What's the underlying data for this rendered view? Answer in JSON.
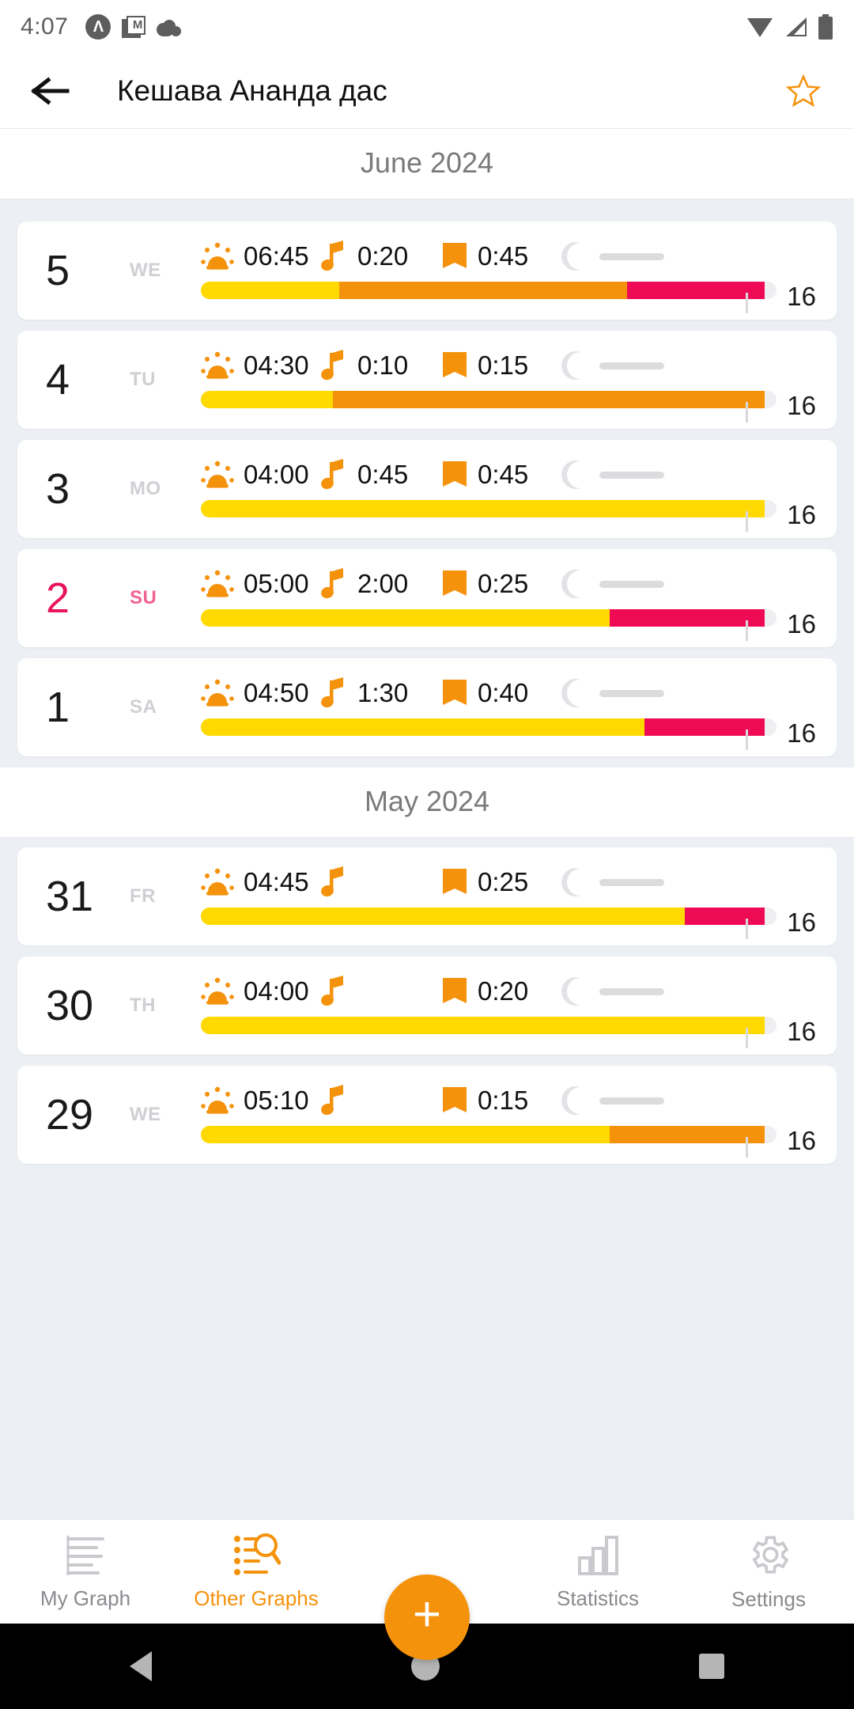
{
  "statusbar": {
    "time": "4:07",
    "icons_left": [
      "app-circle-icon",
      "gmail-icon",
      "cloud-icon"
    ],
    "icons_right": [
      "wifi-icon",
      "cellular-signal-icon",
      "battery-icon"
    ]
  },
  "appbar": {
    "back_icon": "back-arrow-icon",
    "title": "Кешава Ананда дас",
    "favorite_icon": "star-outline-icon",
    "favorite_color": "#f5920b"
  },
  "colors": {
    "accent": "#f5920b",
    "yellow": "#ffd900",
    "orange": "#f5920b",
    "crimson": "#ef0a55",
    "track": "#efeff2",
    "muted": "#d3d3d8"
  },
  "sections": [
    {
      "month": "June 2024",
      "days": [
        {
          "date": "5",
          "weekday": "WE",
          "weekend": false,
          "wake": "06:45",
          "music": "0:20",
          "reading": "0:45",
          "night": "",
          "segments": [
            {
              "color": "#ffd900",
              "pct": 24
            },
            {
              "color": "#f5920b",
              "pct": 50
            },
            {
              "color": "#ef0a55",
              "pct": 24
            }
          ],
          "score": "16"
        },
        {
          "date": "4",
          "weekday": "TU",
          "weekend": false,
          "wake": "04:30",
          "music": "0:10",
          "reading": "0:15",
          "night": "",
          "segments": [
            {
              "color": "#ffd900",
              "pct": 23
            },
            {
              "color": "#f5920b",
              "pct": 75
            }
          ],
          "score": "16"
        },
        {
          "date": "3",
          "weekday": "MO",
          "weekend": false,
          "wake": "04:00",
          "music": "0:45",
          "reading": "0:45",
          "night": "",
          "segments": [
            {
              "color": "#ffd900",
              "pct": 98
            }
          ],
          "score": "16"
        },
        {
          "date": "2",
          "weekday": "SU",
          "weekend": true,
          "wake": "05:00",
          "music": "2:00",
          "reading": "0:25",
          "night": "",
          "segments": [
            {
              "color": "#ffd900",
              "pct": 71
            },
            {
              "color": "#ef0a55",
              "pct": 27
            }
          ],
          "score": "16"
        },
        {
          "date": "1",
          "weekday": "SA",
          "weekend": false,
          "wake": "04:50",
          "music": "1:30",
          "reading": "0:40",
          "night": "",
          "segments": [
            {
              "color": "#ffd900",
              "pct": 77
            },
            {
              "color": "#ef0a55",
              "pct": 21
            }
          ],
          "score": "16"
        }
      ]
    },
    {
      "month": "May 2024",
      "days": [
        {
          "date": "31",
          "weekday": "FR",
          "weekend": false,
          "wake": "04:45",
          "music": "",
          "reading": "0:25",
          "night": "",
          "segments": [
            {
              "color": "#ffd900",
              "pct": 84
            },
            {
              "color": "#ef0a55",
              "pct": 14
            }
          ],
          "score": "16"
        },
        {
          "date": "30",
          "weekday": "TH",
          "weekend": false,
          "wake": "04:00",
          "music": "",
          "reading": "0:20",
          "night": "",
          "segments": [
            {
              "color": "#ffd900",
              "pct": 98
            }
          ],
          "score": "16"
        },
        {
          "date": "29",
          "weekday": "WE",
          "weekend": false,
          "wake": "05:10",
          "music": "",
          "reading": "0:15",
          "night": "",
          "segments": [
            {
              "color": "#ffd900",
              "pct": 71
            },
            {
              "color": "#f5920b",
              "pct": 27
            }
          ],
          "score": "16"
        }
      ]
    }
  ],
  "bottomnav": {
    "items": [
      {
        "label": "My Graph",
        "icon": "lines-graph-icon",
        "active": false
      },
      {
        "label": "Other Graphs",
        "icon": "list-search-icon",
        "active": true
      },
      {
        "label": "Statistics",
        "icon": "bar-chart-icon",
        "active": false
      },
      {
        "label": "Settings",
        "icon": "gear-icon",
        "active": false
      }
    ],
    "fab": {
      "icon": "plus-icon",
      "color": "#f5920b"
    }
  },
  "androidnav": {
    "back": "triangle-back-icon",
    "home": "circle-home-icon",
    "recents": "square-recents-icon"
  }
}
